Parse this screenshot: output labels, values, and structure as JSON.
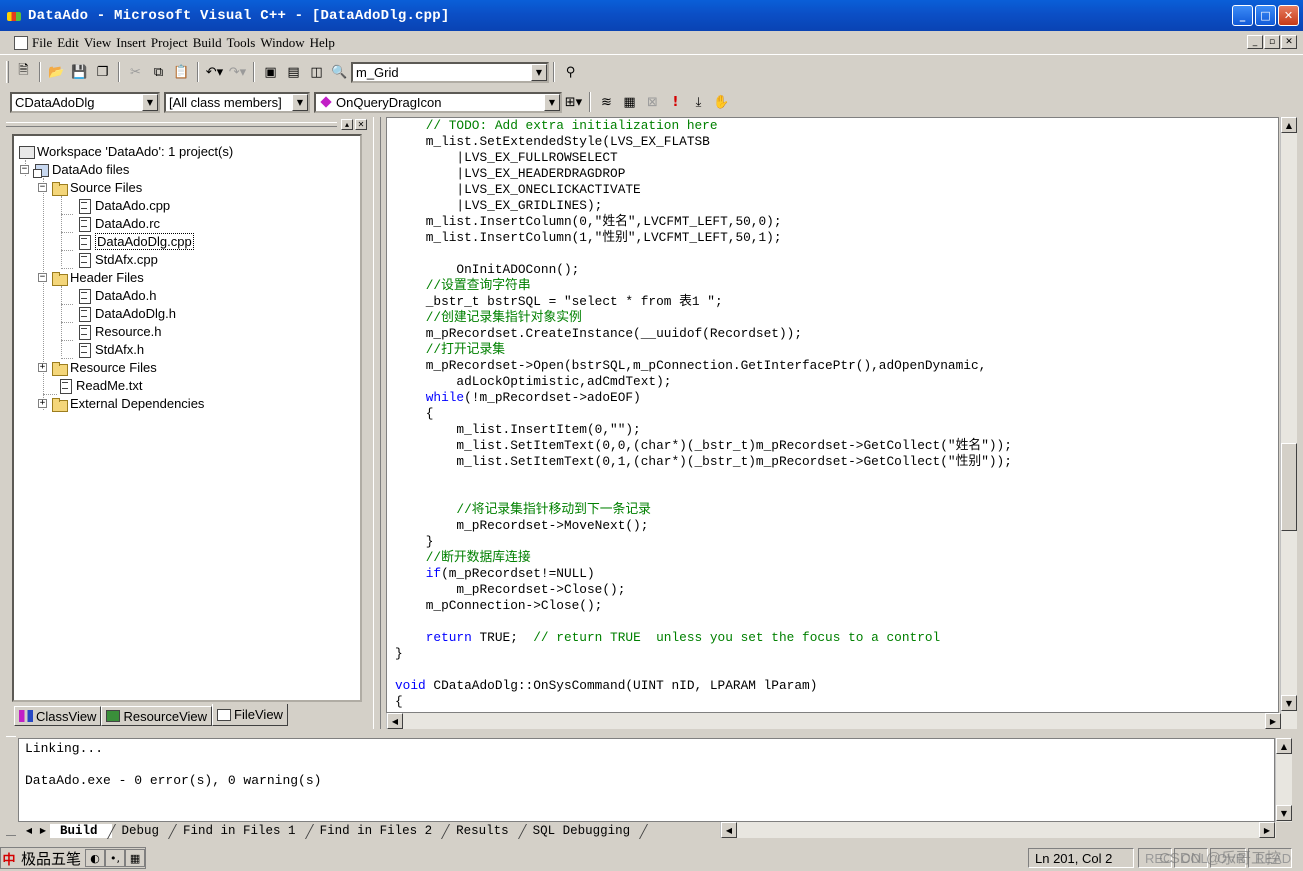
{
  "window": {
    "title": "DataAdo - Microsoft Visual C++ - [DataAdoDlg.cpp]",
    "controls": [
      "_",
      "□",
      "✕"
    ]
  },
  "menu": {
    "items": [
      "File",
      "Edit",
      "View",
      "Insert",
      "Project",
      "Build",
      "Tools",
      "Window",
      "Help"
    ],
    "mdi_controls": [
      "_",
      "▫",
      "✕"
    ]
  },
  "toolbar1": {
    "find_combo": "m_Grid"
  },
  "toolbar2": {
    "class_combo": "CDataAdoDlg",
    "filter_combo": "[All class members]",
    "member_combo": "OnQueryDragIcon"
  },
  "workspace": {
    "tree": [
      "Workspace 'DataAdo': 1 project(s)",
      "DataAdo files",
      "Source Files",
      "DataAdo.cpp",
      "DataAdo.rc",
      "DataAdoDlg.cpp",
      "StdAfx.cpp",
      "Header Files",
      "DataAdo.h",
      "DataAdoDlg.h",
      "Resource.h",
      "StdAfx.h",
      "Resource Files",
      "ReadMe.txt",
      "External Dependencies"
    ],
    "tabs": [
      "ClassView",
      "ResourceView",
      "FileView"
    ]
  },
  "editor": {
    "lines": [
      "    // TODO: Add extra initialization here",
      "    m_list.SetExtendedStyle(LVS_EX_FLATSB",
      "        |LVS_EX_FULLROWSELECT",
      "        |LVS_EX_HEADERDRAGDROP",
      "        |LVS_EX_ONECLICKACTIVATE",
      "        |LVS_EX_GRIDLINES);",
      "    m_list.InsertColumn(0,\"姓名\",LVCFMT_LEFT,50,0);",
      "    m_list.InsertColumn(1,\"性别\",LVCFMT_LEFT,50,1);",
      "",
      "        OnInitADOConn();",
      "    //设置查询字符串",
      "    _bstr_t bstrSQL = \"select * from 表1 \";",
      "    //创建记录集指针对象实例",
      "    m_pRecordset.CreateInstance(__uuidof(Recordset));",
      "    //打开记录集",
      "    m_pRecordset->Open(bstrSQL,m_pConnection.GetInterfacePtr(),adOpenDynamic,",
      "        adLockOptimistic,adCmdText);",
      "    while(!m_pRecordset->adoEOF)",
      "    {",
      "        m_list.InsertItem(0,\"\");",
      "        m_list.SetItemText(0,0,(char*)(_bstr_t)m_pRecordset->GetCollect(\"姓名\"));",
      "        m_list.SetItemText(0,1,(char*)(_bstr_t)m_pRecordset->GetCollect(\"性别\"));",
      "",
      "",
      "        //将记录集指针移动到下一条记录",
      "        m_pRecordset->MoveNext();",
      "    }",
      "    //断开数据库连接",
      "    if(m_pRecordset!=NULL)",
      "        m_pRecordset->Close();",
      "    m_pConnection->Close();",
      "",
      "    return TRUE;  // return TRUE  unless you set the focus to a control",
      "}",
      "",
      "void CDataAdoDlg::OnSysCommand(UINT nID, LPARAM lParam)",
      "{"
    ]
  },
  "output": {
    "lines": [
      "Linking...",
      "",
      "DataAdo.exe - 0 error(s), 0 warning(s)"
    ],
    "tabs": [
      "Build",
      "Debug",
      "Find in Files 1",
      "Find in Files 2",
      "Results",
      "SQL Debugging"
    ]
  },
  "statusbar": {
    "ime_name": "极品五笔",
    "position": "Ln 201, Col 2",
    "indicators": [
      "REC",
      "COL",
      "OVR",
      "READ"
    ],
    "watermark": "CSDN @乐哥工控"
  },
  "colors": {
    "comment": "#008000",
    "keyword": "#0000ff",
    "titlebar": "#0b4fc6"
  }
}
